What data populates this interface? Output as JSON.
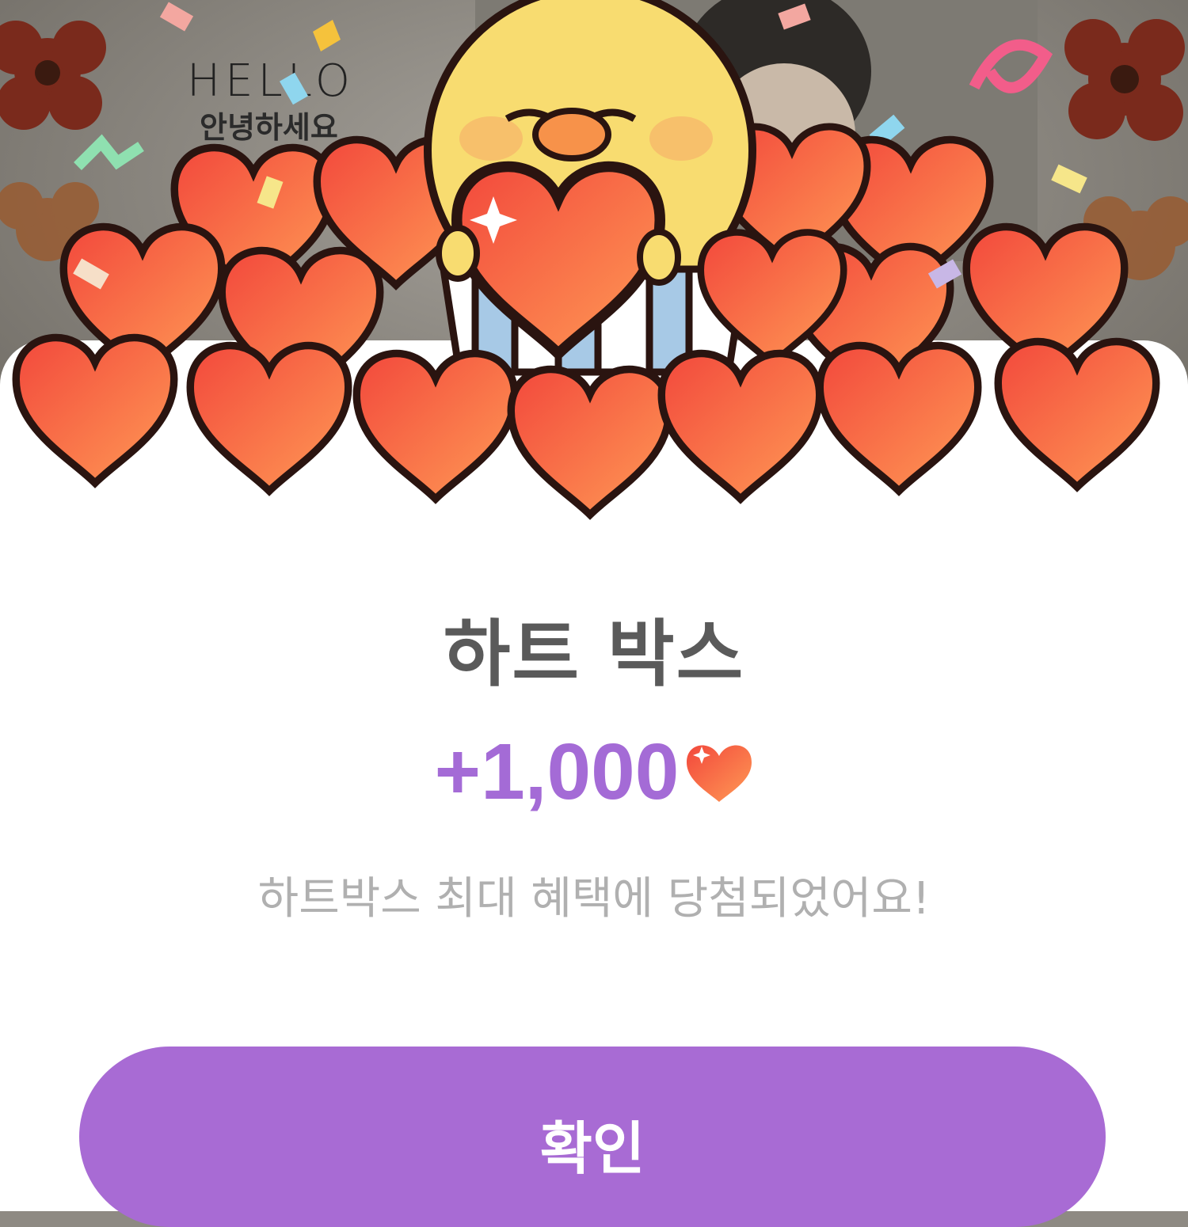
{
  "background": {
    "sticker_text_en": "HELLO",
    "sticker_text_ko": "안녕하세요"
  },
  "dialog": {
    "title": "하트 박스",
    "reward_amount": "+1,000",
    "reward_icon": "heart-icon",
    "message": "하트박스 최대 혜택에 당첨되었어요!",
    "confirm_label": "확인"
  },
  "colors": {
    "accent": "#a86bd4",
    "amount": "#a46bd6",
    "title": "#5a5a5a",
    "message": "#b0b0b0",
    "heart_start": "#f2483c",
    "heart_end": "#ff9a55"
  }
}
